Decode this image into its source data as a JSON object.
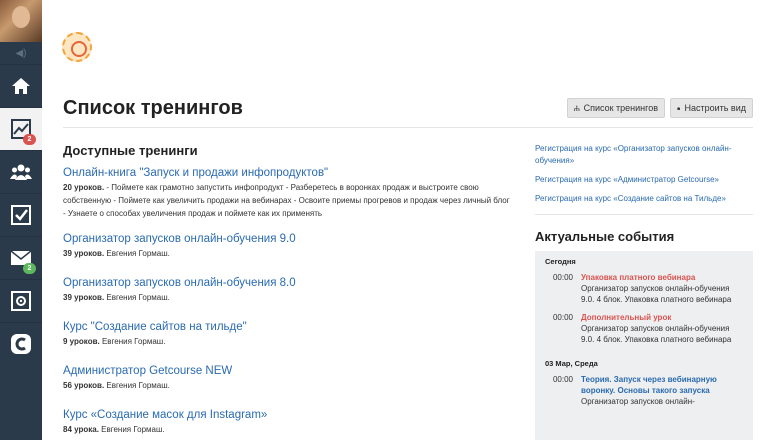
{
  "sidebar": {
    "items": [
      {
        "name": "home",
        "badge": ""
      },
      {
        "name": "stats",
        "badge": "2"
      },
      {
        "name": "users",
        "badge": ""
      },
      {
        "name": "tasks",
        "badge": ""
      },
      {
        "name": "messages",
        "badge": "2"
      },
      {
        "name": "settings",
        "badge": ""
      },
      {
        "name": "getcourse",
        "badge": ""
      }
    ]
  },
  "header": {
    "title": "Список тренингов",
    "btn_list": "Список тренингов",
    "btn_view": "Настроить вид"
  },
  "available": {
    "title": "Доступные тренинги",
    "trainings": [
      {
        "title": "Онлайн-книга \"Запуск и продажи инфопродуктов\"",
        "lessons": "20 уроков.",
        "desc": " - Поймете как грамотно запустить инфопродукт - Разберетесь в воронках продаж и выстроите свою собственную - Поймете как увеличить продажи на вебинарах - Освоите приемы прогревов и продаж через личный блог - Узнаете о способах увеличения продаж и поймете как их применять"
      },
      {
        "title": "Организатор запусков онлайн-обучения 9.0",
        "lessons": "39 уроков.",
        "desc": " Евгения Гормаш."
      },
      {
        "title": "Организатор запусков онлайн-обучения 8.0",
        "lessons": "39 уроков.",
        "desc": " Евгения Гормаш."
      },
      {
        "title": "Курс \"Создание сайтов на тильде\"",
        "lessons": "9 уроков.",
        "desc": " Евгения Гормаш."
      },
      {
        "title": "Администратор Getcourse NEW",
        "lessons": "56 уроков.",
        "desc": " Евгения Гормаш."
      },
      {
        "title": "Курс «Создание масок для Instagram»",
        "lessons": "84 урока.",
        "desc": " Евгения Гормаш."
      }
    ]
  },
  "registrations": [
    "Регистрация на курс «Организатор запусков онлайн-обучения»",
    "Регистрация на курс «Администратор Getcourse»",
    "Регистрация на курс «Создание сайтов на Тильде»"
  ],
  "events": {
    "title": "Актуальные события",
    "days": [
      {
        "label": "Сегодня",
        "items": [
          {
            "time": "00:00",
            "title": "Упаковка платного вебинара",
            "desc": "Организатор запусков онлайн-обучения 9.0. 4 блок. Упаковка платного вебинара",
            "color": "#d9534f"
          },
          {
            "time": "00:00",
            "title": "Дополнительный урок",
            "desc": "Организатор запусков онлайн-обучения 9.0. 4 блок. Упаковка платного вебинара",
            "color": "#d9534f"
          }
        ]
      },
      {
        "label": "03 Мар, Среда",
        "items": [
          {
            "time": "00:00",
            "title": "Теория. Запуск через вебинарную воронку. Основы такого запуска",
            "desc": "Организатор запусков онлайн-",
            "color": "#2a6bb0"
          }
        ]
      }
    ]
  }
}
